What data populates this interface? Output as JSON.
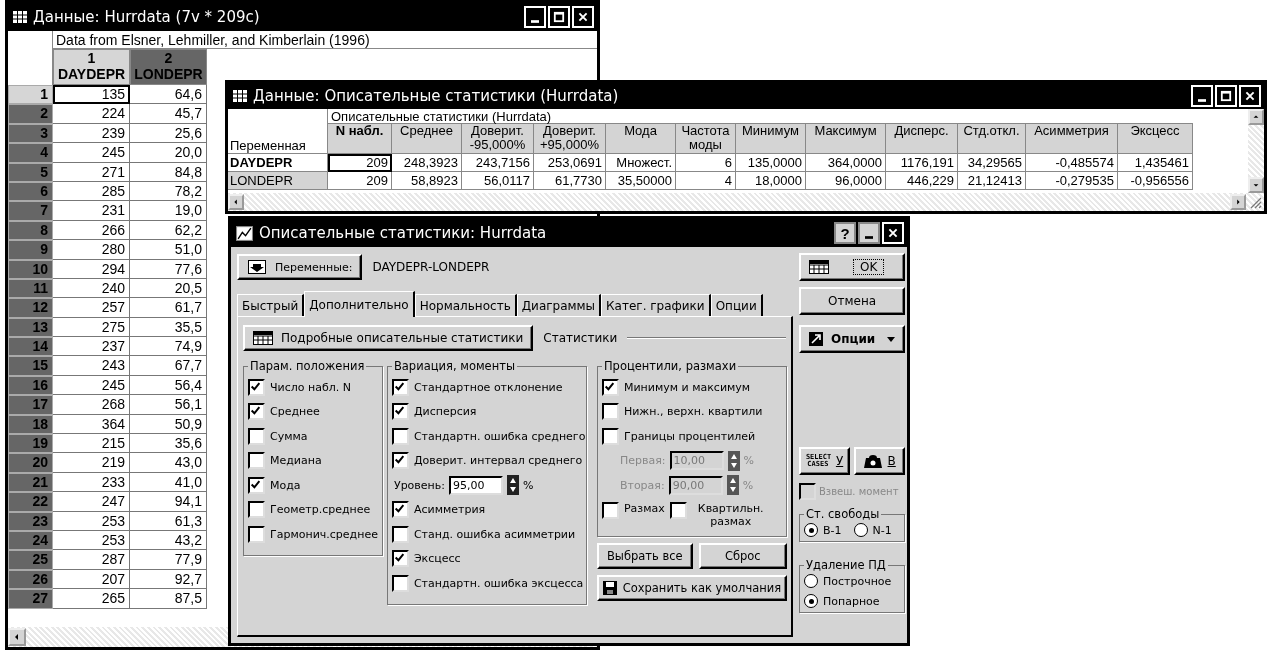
{
  "data_window": {
    "title": "Данные: Hurrdata (7v * 209c)",
    "note": "Data from Elsner, Lehmiller, and Kimberlain (1996)",
    "columns": [
      {
        "index": "1",
        "name": "DAYDEPR",
        "selected": true
      },
      {
        "index": "2",
        "name": "LONDEPR",
        "selected": false
      }
    ],
    "rows": [
      {
        "label": "1",
        "selected": true,
        "cells": [
          "135",
          "64,6"
        ]
      },
      {
        "label": "2",
        "selected": false,
        "cells": [
          "224",
          "45,7"
        ]
      },
      {
        "label": "3",
        "selected": false,
        "cells": [
          "239",
          "25,6"
        ]
      },
      {
        "label": "4",
        "selected": false,
        "cells": [
          "245",
          "20,0"
        ]
      },
      {
        "label": "5",
        "selected": false,
        "cells": [
          "271",
          "84,8"
        ]
      },
      {
        "label": "6",
        "selected": false,
        "cells": [
          "285",
          "78,2"
        ]
      },
      {
        "label": "7",
        "selected": false,
        "cells": [
          "231",
          "19,0"
        ]
      },
      {
        "label": "8",
        "selected": false,
        "cells": [
          "266",
          "62,2"
        ]
      },
      {
        "label": "9",
        "selected": false,
        "cells": [
          "280",
          "51,0"
        ]
      },
      {
        "label": "10",
        "selected": false,
        "cells": [
          "294",
          "77,6"
        ]
      },
      {
        "label": "11",
        "selected": false,
        "cells": [
          "240",
          "20,5"
        ]
      },
      {
        "label": "12",
        "selected": false,
        "cells": [
          "257",
          "61,7"
        ]
      },
      {
        "label": "13",
        "selected": false,
        "cells": [
          "275",
          "35,5"
        ]
      },
      {
        "label": "14",
        "selected": false,
        "cells": [
          "237",
          "74,9"
        ]
      },
      {
        "label": "15",
        "selected": false,
        "cells": [
          "243",
          "67,7"
        ]
      },
      {
        "label": "16",
        "selected": false,
        "cells": [
          "245",
          "56,4"
        ]
      },
      {
        "label": "17",
        "selected": false,
        "cells": [
          "268",
          "56,1"
        ]
      },
      {
        "label": "18",
        "selected": false,
        "cells": [
          "364",
          "50,9"
        ]
      },
      {
        "label": "19",
        "selected": false,
        "cells": [
          "215",
          "35,6"
        ]
      },
      {
        "label": "20",
        "selected": false,
        "cells": [
          "219",
          "43,0"
        ]
      },
      {
        "label": "21",
        "selected": false,
        "cells": [
          "233",
          "41,0"
        ]
      },
      {
        "label": "22",
        "selected": false,
        "cells": [
          "247",
          "94,1"
        ]
      },
      {
        "label": "23",
        "selected": false,
        "cells": [
          "253",
          "61,3"
        ]
      },
      {
        "label": "24",
        "selected": false,
        "cells": [
          "253",
          "43,2"
        ]
      },
      {
        "label": "25",
        "selected": false,
        "cells": [
          "287",
          "77,9"
        ]
      },
      {
        "label": "26",
        "selected": false,
        "cells": [
          "207",
          "92,7"
        ]
      },
      {
        "label": "27",
        "selected": false,
        "cells": [
          "265",
          "87,5"
        ]
      }
    ]
  },
  "stats_window": {
    "title": "Данные: Описательные статистики (Hurrdata)",
    "table_title": "Описательные статистики (Hurrdata)",
    "first_header": "Переменная",
    "columns": [
      "N набл.",
      "Среднее",
      "Доверит.\n-95,000%",
      "Доверит.\n+95,000%",
      "Мода",
      "Частота\nмоды",
      "Минимум",
      "Максимум",
      "Дисперс.",
      "Стд.откл.",
      "Асимметрия",
      "Эксцесс"
    ],
    "rows": [
      {
        "name": "DAYDEPR",
        "selected": true,
        "cells": [
          "209",
          "248,3923",
          "243,7156",
          "253,0691",
          "Множест.",
          "6",
          "135,0000",
          "364,0000",
          "1176,191",
          "34,29565",
          "-0,485574",
          "1,435461"
        ]
      },
      {
        "name": "LONDEPR",
        "selected": false,
        "cells": [
          "209",
          "58,8923",
          "56,0117",
          "61,7730",
          "35,50000",
          "4",
          "18,0000",
          "96,0000",
          "446,229",
          "21,12413",
          "-0,279535",
          "-0,956556"
        ]
      }
    ]
  },
  "dialog": {
    "title": "Описательные статистики: Hurrdata",
    "help_button": "?",
    "variables_button": "Переменные:",
    "variables_value": "DAYDEPR-LONDEPR",
    "tabs": [
      {
        "label": "Быстрый",
        "selected": false
      },
      {
        "label": "Дополнительно",
        "selected": true
      },
      {
        "label": "Нормальность",
        "selected": false
      },
      {
        "label": "Диаграммы",
        "selected": false
      },
      {
        "label": "Катег. графики",
        "selected": false
      },
      {
        "label": "Опции",
        "selected": false
      }
    ],
    "summary_button": "Подробные описательные статистики",
    "section_label": "Статистики",
    "groups": [
      {
        "title": "Парам. положения",
        "items": [
          {
            "kind": "checkbox",
            "label": "Число набл. N",
            "checked": true
          },
          {
            "kind": "checkbox",
            "label": "Среднее",
            "checked": true
          },
          {
            "kind": "checkbox",
            "label": "Сумма",
            "checked": false
          },
          {
            "kind": "checkbox",
            "label": "Медиана",
            "checked": false
          },
          {
            "kind": "checkbox",
            "label": "Мода",
            "checked": true
          },
          {
            "kind": "checkbox",
            "label": "Геометр.среднее",
            "checked": false
          },
          {
            "kind": "checkbox",
            "label": "Гармонич.среднее",
            "checked": false
          }
        ]
      },
      {
        "title": "Вариация, моменты",
        "items": [
          {
            "kind": "checkbox",
            "label": "Стандартное отклонение",
            "checked": true
          },
          {
            "kind": "checkbox",
            "label": "Дисперсия",
            "checked": true
          },
          {
            "kind": "checkbox",
            "label": "Стандартн. ошибка среднего",
            "checked": false
          },
          {
            "kind": "checkbox",
            "label": "Доверит. интервал среднего",
            "checked": true
          },
          {
            "kind": "spin",
            "label": "Уровень:",
            "value": "95,00",
            "unit": "%",
            "disabled": false
          },
          {
            "kind": "checkbox",
            "label": "Асимметрия",
            "checked": true
          },
          {
            "kind": "checkbox",
            "label": "Станд. ошибка асимметрии",
            "checked": false
          },
          {
            "kind": "checkbox",
            "label": "Эксцесс",
            "checked": true
          },
          {
            "kind": "checkbox",
            "label": "Стандартн. ошибка эксцесса",
            "checked": false
          }
        ]
      },
      {
        "title": "Процентили, размахи",
        "items": [
          {
            "kind": "checkbox",
            "label": "Минимум и максимум",
            "checked": true
          },
          {
            "kind": "checkbox",
            "label": "Нижн., верхн. квартили",
            "checked": false
          },
          {
            "kind": "checkbox",
            "label": "Границы процентилей",
            "checked": false
          },
          {
            "kind": "spin",
            "label": "Первая:",
            "value": "10,00",
            "unit": "%",
            "disabled": true
          },
          {
            "kind": "spin",
            "label": "Вторая:",
            "value": "90,00",
            "unit": "%",
            "disabled": true
          },
          {
            "kind": "pair",
            "items": [
              {
                "label": "Размах",
                "checked": false
              },
              {
                "label": "Квартильн. размах",
                "checked": false
              }
            ]
          }
        ]
      }
    ],
    "buttons": [
      "Выбрать все",
      "Сброс"
    ],
    "save_button": "Сохранить как умолчания",
    "ok_button": "OK",
    "cancel_button": "Отмена",
    "options_button": "Опции",
    "select_cases": {
      "icon_text": "SELECT CASES",
      "key": "У"
    },
    "weight_button": {
      "key": "В"
    },
    "weighted_moment": {
      "label": "Взвеш. момент",
      "checked": false,
      "disabled": true
    },
    "dof": {
      "title": "Ст. свободы",
      "options": [
        {
          "label": "В-1",
          "selected": true
        },
        {
          "label": "N-1",
          "selected": false
        }
      ]
    },
    "md_deletion": {
      "title": "Удаление ПД",
      "options": [
        {
          "label": "Построчное",
          "selected": false
        },
        {
          "label": "Попарное",
          "selected": true
        }
      ]
    }
  }
}
